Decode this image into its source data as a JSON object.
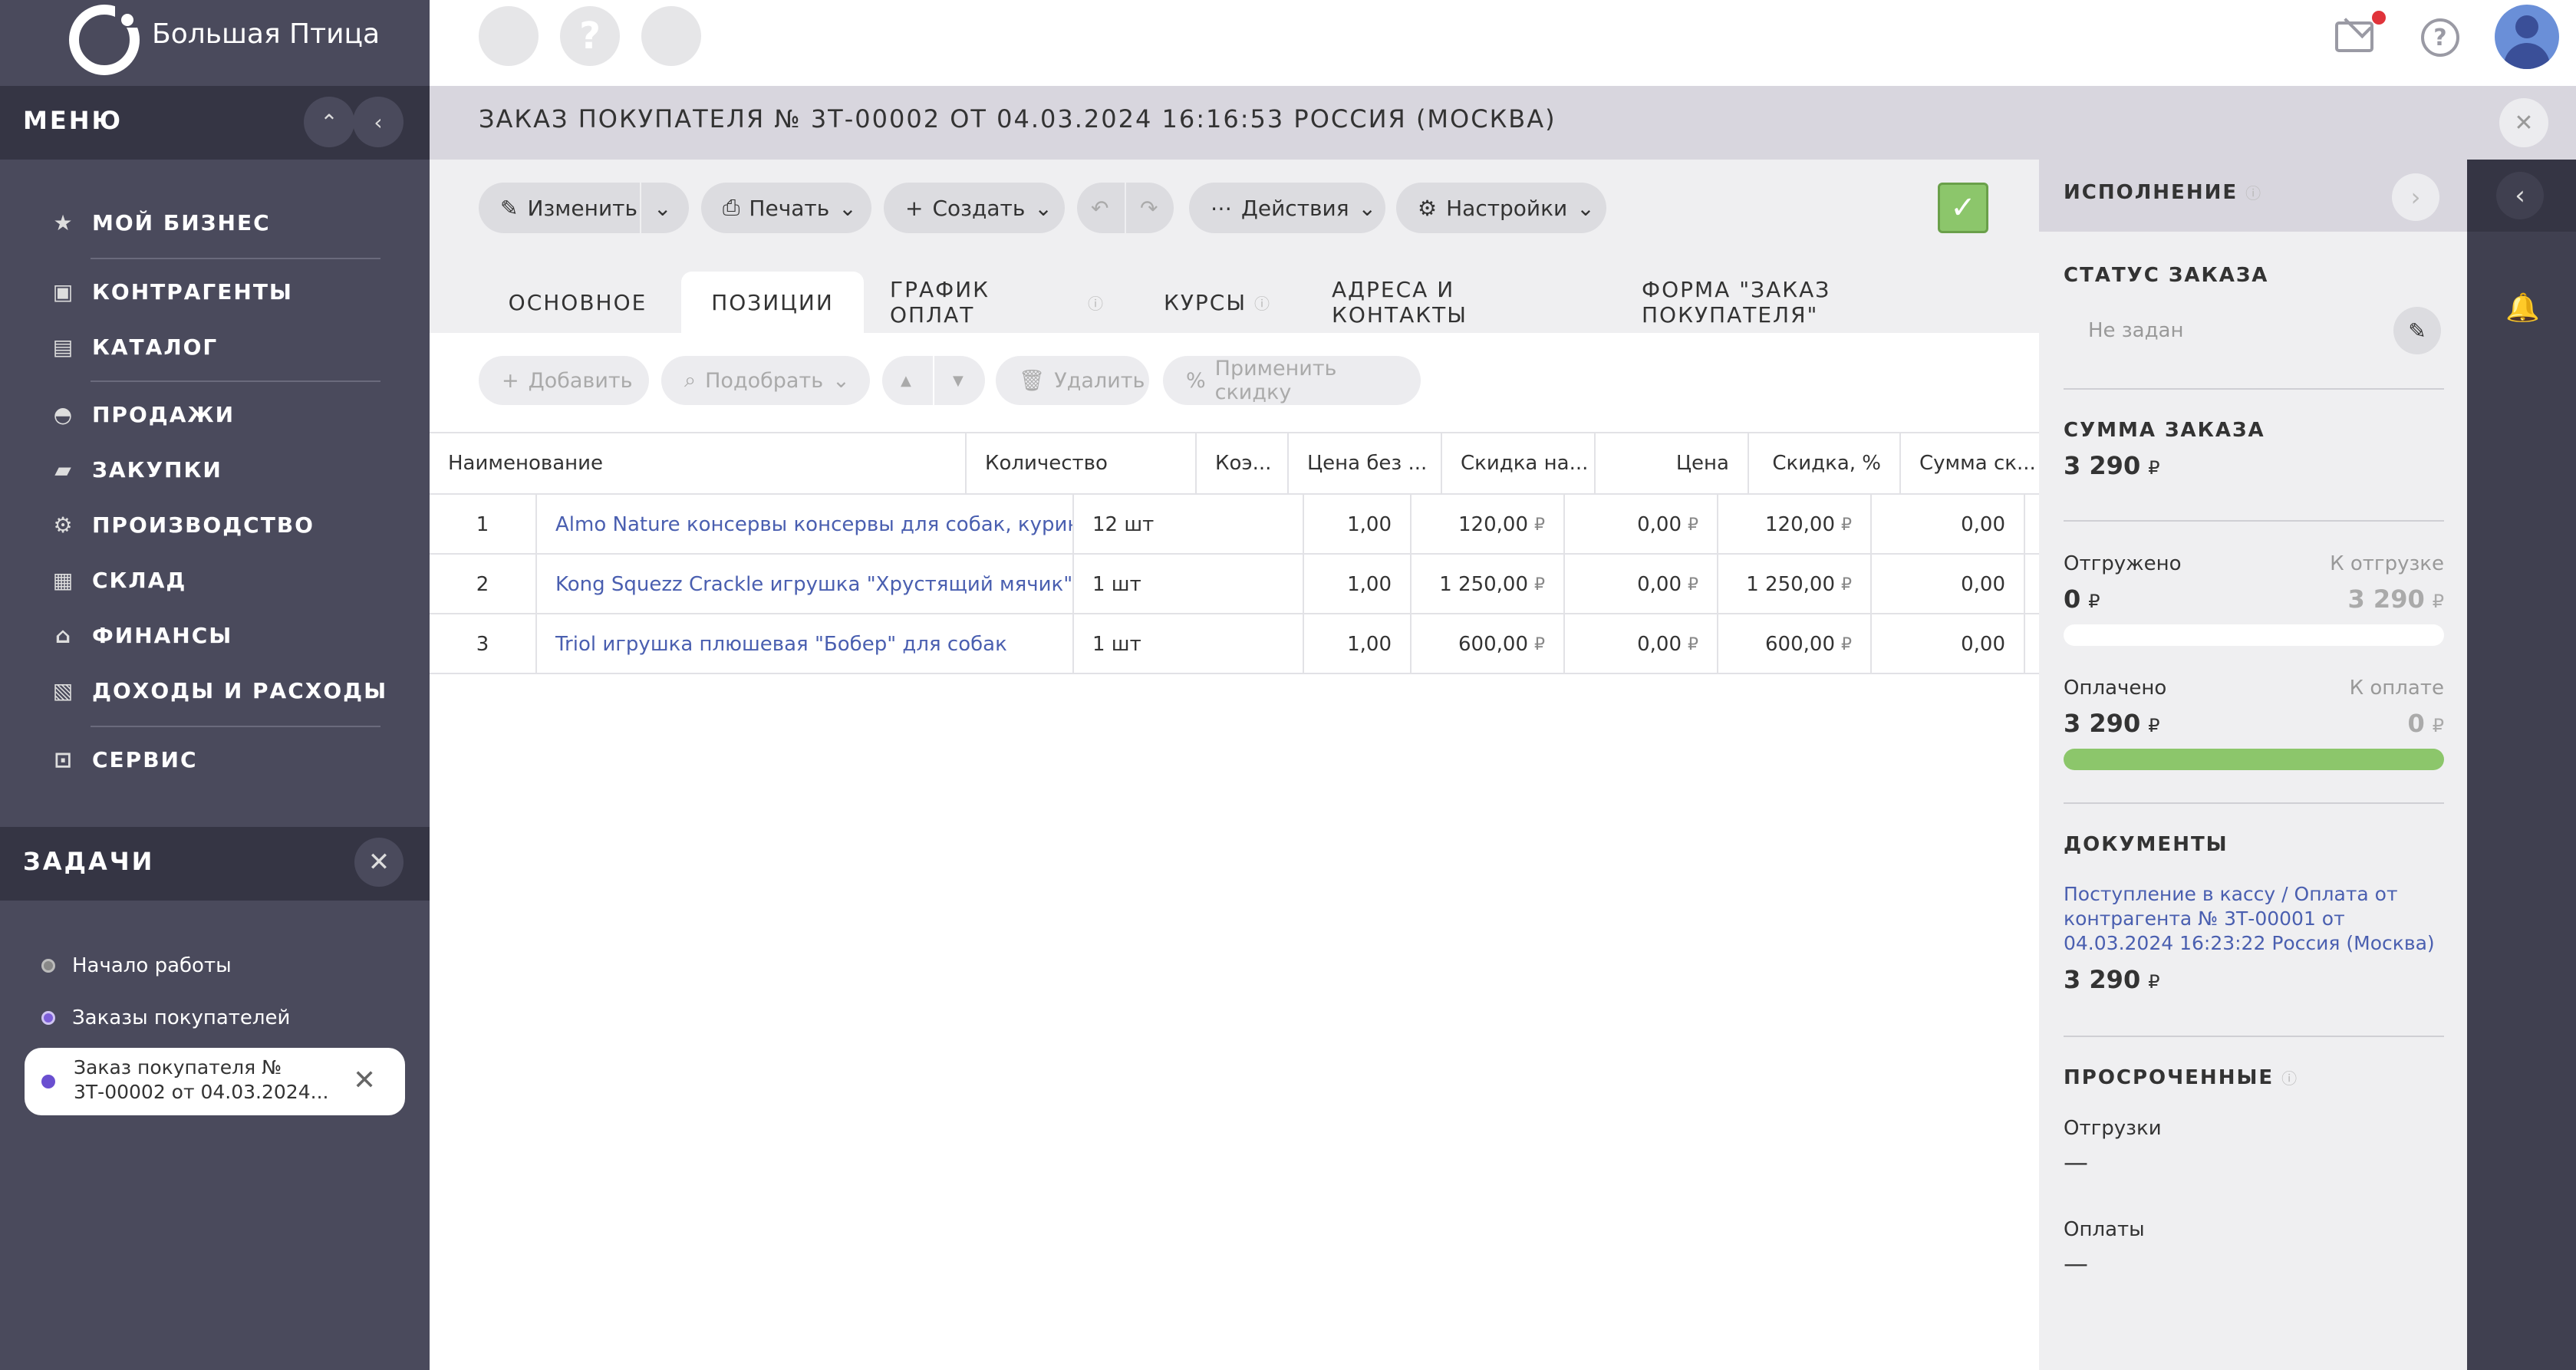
{
  "brand": {
    "name": "Большая Птица"
  },
  "menu": {
    "title": "МЕНЮ",
    "items": [
      {
        "label": "МОЙ БИЗНЕС",
        "icon": "star-icon"
      },
      {
        "label": "КОНТРАГЕНТЫ",
        "icon": "briefcase-icon"
      },
      {
        "label": "КАТАЛОГ",
        "icon": "book-icon"
      },
      {
        "label": "ПРОДАЖИ",
        "icon": "basket-icon"
      },
      {
        "label": "ЗАКУПКИ",
        "icon": "truck-icon"
      },
      {
        "label": "ПРОИЗВОДСТВО",
        "icon": "factory-icon"
      },
      {
        "label": "СКЛАД",
        "icon": "warehouse-icon"
      },
      {
        "label": "ФИНАНСЫ",
        "icon": "bank-icon"
      },
      {
        "label": "ДОХОДЫ И РАСХОДЫ",
        "icon": "wallet-icon"
      },
      {
        "label": "СЕРВИС",
        "icon": "service-icon"
      }
    ]
  },
  "tasks": {
    "title": "ЗАДАЧИ",
    "items": [
      {
        "label": "Начало работы"
      },
      {
        "label": "Заказы покупателей"
      }
    ],
    "active": {
      "line1": "Заказ покупателя №",
      "line2": "3Т-00002 от 04.03.2024..."
    }
  },
  "document": {
    "title": "ЗАКАЗ ПОКУПАТЕЛЯ № 3Т-00002 ОТ 04.03.2024 16:16:53 РОССИЯ (МОСКВА)"
  },
  "toolbar": {
    "edit": "Изменить",
    "print": "Печать",
    "create": "Создать",
    "actions": "Действия",
    "settings": "Настройки"
  },
  "tabs": [
    {
      "label": "ОСНОВНОЕ"
    },
    {
      "label": "ПОЗИЦИИ"
    },
    {
      "label": "ГРАФИК ОПЛАТ"
    },
    {
      "label": "КУРСЫ"
    },
    {
      "label": "АДРЕСА И КОНТАКТЫ"
    },
    {
      "label": "ФОРМА \"ЗАКАЗ ПОКУПАТЕЛЯ\""
    }
  ],
  "positions_toolbar": {
    "add": "Добавить",
    "pick": "Подобрать",
    "delete": "Удалить",
    "discount": "Применить скидку"
  },
  "table": {
    "headers": [
      "Наименование",
      "Количество",
      "Коэ...",
      "Цена без ...",
      "Скидка на...",
      "Цена",
      "Скидка, %",
      "Сумма ск..."
    ],
    "currency": "₽",
    "rows": [
      {
        "n": "1",
        "name": "Almo Nature консервы консервы для собак, курины...",
        "qty": "12 шт",
        "coef": "1,00",
        "price_nodisc": "120,00",
        "disc_amount": "0,00",
        "price": "120,00",
        "disc_pct": "0,00"
      },
      {
        "n": "2",
        "name": "Kong Squezz Crackle игрушка \"Хрустящий мячик\" дл...",
        "qty": "1 шт",
        "coef": "1,00",
        "price_nodisc": "1 250,00",
        "disc_amount": "0,00",
        "price": "1 250,00",
        "disc_pct": "0,00"
      },
      {
        "n": "3",
        "name": "Triol игрушка плюшевая \"Бобер\" для собак",
        "qty": "1 шт",
        "coef": "1,00",
        "price_nodisc": "600,00",
        "disc_amount": "0,00",
        "price": "600,00",
        "disc_pct": "0,00"
      }
    ]
  },
  "execution": {
    "title": "ИСПОЛНЕНИЕ",
    "status_label": "СТАТУС ЗАКАЗА",
    "status_value": "Не задан",
    "sum_label": "СУММА ЗАКАЗА",
    "sum_value": "3 290",
    "shipped_label": "Отгружено",
    "shipped_value": "0",
    "to_ship_label": "К отгрузке",
    "to_ship_value": "3 290",
    "shipped_fraction": 0,
    "paid_label": "Оплачено",
    "paid_value": "3 290",
    "to_pay_label": "К оплате",
    "to_pay_value": "0",
    "paid_fraction": 1.0,
    "paid_bar_color": "#8cc66b",
    "docs_label": "ДОКУМЕНТЫ",
    "doc_link": "Поступление в кассу / Оплата от контрагента № 3Т-00001 от 04.03.2024 16:23:22 Россия (Москва)",
    "doc_sum": "3 290",
    "overdue_label": "ПРОСРОЧЕННЫЕ",
    "shipments_label": "Отгрузки",
    "shipments_value": "—",
    "payments_label": "Оплаты",
    "payments_value": "—",
    "currency": "₽"
  },
  "colors": {
    "accent": "#4a5fb0",
    "sidebar": "#4a4a5c",
    "ok_green": "#8cc66b"
  }
}
